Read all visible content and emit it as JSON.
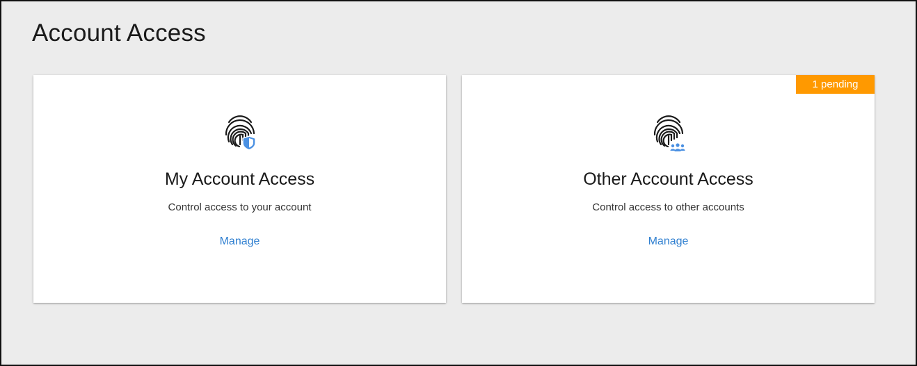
{
  "page": {
    "title": "Account Access"
  },
  "cards": [
    {
      "title": "My Account Access",
      "description": "Control access to your account",
      "link_label": "Manage",
      "icon": "fingerprint-shield-icon"
    },
    {
      "title": "Other Account Access",
      "description": "Control access to other accounts",
      "link_label": "Manage",
      "icon": "fingerprint-people-icon",
      "badge": "1 pending"
    }
  ],
  "colors": {
    "background": "#ececec",
    "card": "#ffffff",
    "link": "#2f7fd0",
    "badge": "#ff9900",
    "icon_accent": "#4a90e2"
  }
}
